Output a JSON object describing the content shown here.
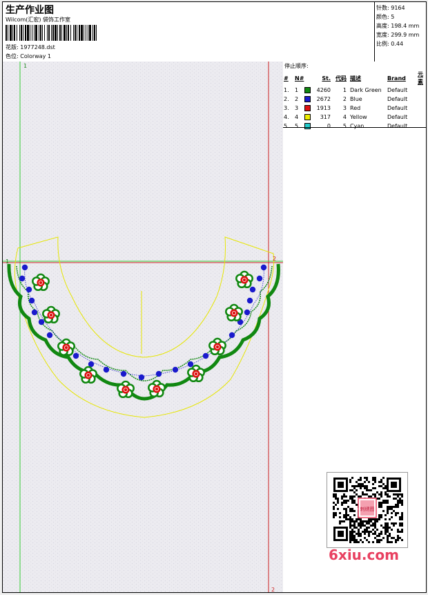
{
  "header": {
    "title": "生产作业图",
    "subtitle": "Wilcom(汇宏) 袋饰工作室",
    "design_label": "花版:",
    "design_value": "1977248.dst",
    "colorway_label": "色位:",
    "colorway_value": "Colorway 1"
  },
  "info": {
    "stitches_label": "针数:",
    "stitches_value": "9164",
    "colors_label": "颜色:",
    "colors_value": "5",
    "height_label": "高度:",
    "height_value": "198.4 mm",
    "width_label": "宽度:",
    "width_value": "299.9 mm",
    "scale_label": "比例:",
    "scale_value": "0.44"
  },
  "stop_sequence": {
    "title": "停止顺序:",
    "columns": [
      "#",
      "N#",
      "St.",
      "代码",
      "描述",
      "Brand",
      "元素"
    ],
    "rows": [
      {
        "num": "1.",
        "n": "1",
        "color": "#118811",
        "stitches": "4260",
        "code": "1",
        "desc": "Dark Green",
        "brand": "Default"
      },
      {
        "num": "2.",
        "n": "2",
        "color": "#1a1acc",
        "stitches": "2672",
        "code": "2",
        "desc": "Blue",
        "brand": "Default"
      },
      {
        "num": "3.",
        "n": "3",
        "color": "#dd1111",
        "stitches": "1913",
        "code": "3",
        "desc": "Red",
        "brand": "Default"
      },
      {
        "num": "4.",
        "n": "4",
        "color": "#eeee00",
        "stitches": "317",
        "code": "4",
        "desc": "Yellow",
        "brand": "Default"
      },
      {
        "num": "5.",
        "n": "5",
        "color": "#22cccc",
        "stitches": "0",
        "code": "5",
        "desc": "Cyan",
        "brand": "Default"
      }
    ]
  },
  "canvas": {
    "marker_left_top": "1",
    "marker_left_mid": "1",
    "marker_right_mid": "2",
    "marker_right_bottom": "2",
    "green_color": "#118811",
    "blue_color": "#1a1acc",
    "red_color": "#dd1111",
    "yellow_color": "#eeee00"
  },
  "watermark": {
    "text": "6xiu.com",
    "stamp": "刺绣图"
  }
}
